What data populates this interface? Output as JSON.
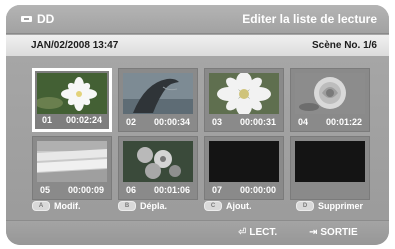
{
  "header": {
    "source_label": "DD",
    "title": "Editer la liste de lecture"
  },
  "info": {
    "datetime": "JAN/02/2008 13:47",
    "scene": "Scène No. 1/6"
  },
  "scenes": [
    {
      "number": "01",
      "time": "00:02:24",
      "icon": "white-flower-image",
      "selected": true
    },
    {
      "number": "02",
      "time": "00:00:34",
      "icon": "dolphin-image"
    },
    {
      "number": "03",
      "time": "00:00:31",
      "icon": "white-flower-image"
    },
    {
      "number": "04",
      "time": "00:01:22",
      "icon": "rose-image"
    },
    {
      "number": "05",
      "time": "00:00:09",
      "icon": "waterfall-image"
    },
    {
      "number": "06",
      "time": "00:01:06",
      "icon": "flower-bunch-image"
    },
    {
      "number": "07",
      "time": "00:00:00",
      "icon": "black-frame"
    }
  ],
  "color_buttons": {
    "a": {
      "key": "A",
      "label": "Modif."
    },
    "b": {
      "key": "B",
      "label": "Dépla."
    },
    "c": {
      "key": "C",
      "label": "Ajout."
    },
    "d": {
      "key": "D",
      "label": "Supprimer"
    }
  },
  "footer": {
    "play_label": "LECT.",
    "exit_label": "SORTIE"
  },
  "colors": {
    "frame": "#9f9f9f",
    "info_bar": "#e6e6e6",
    "text_light": "#ffffff",
    "text_dark": "#1c1c1c"
  }
}
